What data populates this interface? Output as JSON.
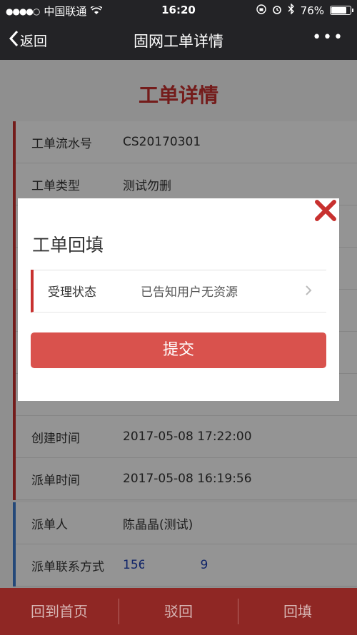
{
  "status": {
    "carrier": "中国联通",
    "time": "16:20",
    "battery": "76%",
    "battery_level": 0.76
  },
  "nav": {
    "back": "返回",
    "title": "固网工单详情",
    "more": "•••"
  },
  "page": {
    "title": "工单详情",
    "rows": [
      {
        "label": "工单流水号",
        "value": "CS20170301"
      },
      {
        "label": "工单类型",
        "value": "测试勿删"
      },
      {
        "label": "",
        "value": ""
      },
      {
        "label": "",
        "value": ""
      },
      {
        "label": "",
        "value": ""
      },
      {
        "label": "",
        "value": ""
      },
      {
        "label": "",
        "value": ""
      },
      {
        "label": "创建时间",
        "value": "2017-05-08 17:22:00"
      },
      {
        "label": "派单时间",
        "value": "2017-05-08 16:19:56"
      }
    ],
    "dispatch": [
      {
        "label": "派单人",
        "value": "陈晶晶(测试)"
      },
      {
        "label": "派单联系方式",
        "value_start": "156",
        "value_end": "9"
      }
    ]
  },
  "modal": {
    "title": "工单回填",
    "field_label": "受理状态",
    "field_value": "已告知用户无资源",
    "submit": "提交"
  },
  "bottom": {
    "home": "回到首页",
    "reject": "驳回",
    "fill": "回填"
  },
  "colors": {
    "accent": "#c8312f",
    "submit": "#d9524d",
    "bottom": "#8f2724",
    "link": "#1b3fb3"
  }
}
